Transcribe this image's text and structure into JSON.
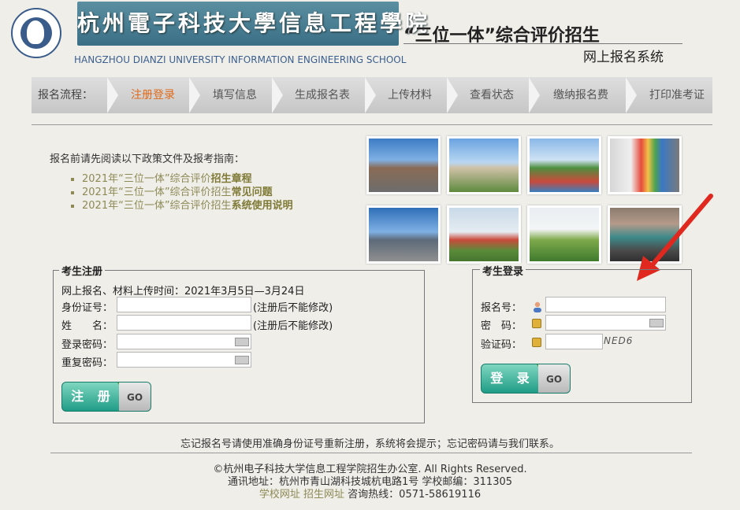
{
  "header": {
    "banner_title": "杭州電子科技大學信息工程學院",
    "school_en": "HANGZHOU DIANZI UNIVERSITY INFORMATION ENGINEERING SCHOOL",
    "slogan": "“三位一体”综合评价招生",
    "system_name": "网上报名系统"
  },
  "nav": {
    "label": "报名流程：",
    "items": [
      "注册登录",
      "填写信息",
      "生成报名表",
      "上传材料",
      "查看状态",
      "缴纳报名费",
      "打印准考证"
    ],
    "active_index": 0
  },
  "intro": {
    "text": "报名前请先阅读以下政策文件及报考指南：",
    "links": [
      {
        "prefix": "2021年“三位一体”综合评价",
        "bold": "招生章程"
      },
      {
        "prefix": "2021年“三位一体”综合评价招生",
        "bold": "常见问题"
      },
      {
        "prefix": "2021年“三位一体”综合评价招生",
        "bold": "系统使用说明"
      }
    ]
  },
  "register": {
    "legend": "考生注册",
    "period": "网上报名、材料上传时间：2021年3月5日—3月24日",
    "id_label": "身份证号：",
    "name_label": "姓　　名：",
    "password_label": "登录密码：",
    "repeat_label": "重复密码：",
    "id_hint": "(注册后不能修改)",
    "name_hint": "(注册后不能修改)",
    "button": "注 册",
    "go": "GO"
  },
  "login": {
    "legend": "考生登录",
    "number_label": "报名号：",
    "password_label": "密　码：",
    "captcha_label": "验证码：",
    "captcha_text": "NED6",
    "button": "登 录",
    "go": "GO"
  },
  "footer": {
    "forget": "忘记报名号请使用准确身份证号重新注册，系统将会提示；忘记密码请与我们联系。",
    "copyright": "©杭州电子科技大学信息工程学院招生办公室. All Rights Reserved.",
    "address": "通讯地址：杭州市青山湖科技城杭电路1号 学校邮编：311305",
    "school_site": "学校网址",
    "admission_site": "招生网址",
    "hotline": "咨询热线：0571-58619116"
  },
  "colors": {
    "accent_orange": "#e06a1a",
    "button_teal": "#1f9c86",
    "link_olive": "#8d8a55",
    "banner_blue": "#3b6f86"
  }
}
